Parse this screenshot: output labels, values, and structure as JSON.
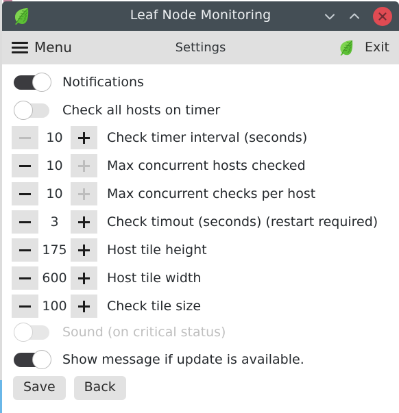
{
  "window": {
    "title": "Leaf Node Monitoring",
    "app_icon": "leaf-icon",
    "controls": {
      "minimize": "chevron-down-icon",
      "maximize": "chevron-up-icon",
      "close": "close-icon"
    },
    "accent_color": "#6ab7e8",
    "titlebar_color": "#444e55"
  },
  "toolbar": {
    "menu_label": "Menu",
    "menu_icon": "hamburger-icon",
    "title": "Settings",
    "exit_label": "Exit",
    "exit_icon": "leaf-icon",
    "background_color": "#e0e0e0"
  },
  "settings": {
    "toggles_top": [
      {
        "label": "Notifications",
        "state": "on",
        "enabled": true
      },
      {
        "label": "Check all hosts on timer",
        "state": "off",
        "enabled": true
      }
    ],
    "spinners": [
      {
        "label": "Check timer interval (seconds)",
        "value": "10",
        "minus_enabled": false,
        "plus_enabled": true
      },
      {
        "label": "Max concurrent hosts checked",
        "value": "10",
        "minus_enabled": true,
        "plus_enabled": false
      },
      {
        "label": "Max concurrent checks per host",
        "value": "10",
        "minus_enabled": true,
        "plus_enabled": false
      },
      {
        "label": "Check timout (seconds) (restart required)",
        "value": "3",
        "minus_enabled": true,
        "plus_enabled": true
      },
      {
        "label": "Host tile height",
        "value": "175",
        "minus_enabled": true,
        "plus_enabled": true
      },
      {
        "label": "Host tile width",
        "value": "600",
        "minus_enabled": true,
        "plus_enabled": true
      },
      {
        "label": "Check tile size",
        "value": "100",
        "minus_enabled": true,
        "plus_enabled": true
      }
    ],
    "toggles_bottom": [
      {
        "label": "Sound (on critical status)",
        "state": "off",
        "enabled": false
      },
      {
        "label": "Show message if update is available.",
        "state": "on",
        "enabled": true
      }
    ]
  },
  "actions": {
    "save_label": "Save",
    "back_label": "Back"
  }
}
